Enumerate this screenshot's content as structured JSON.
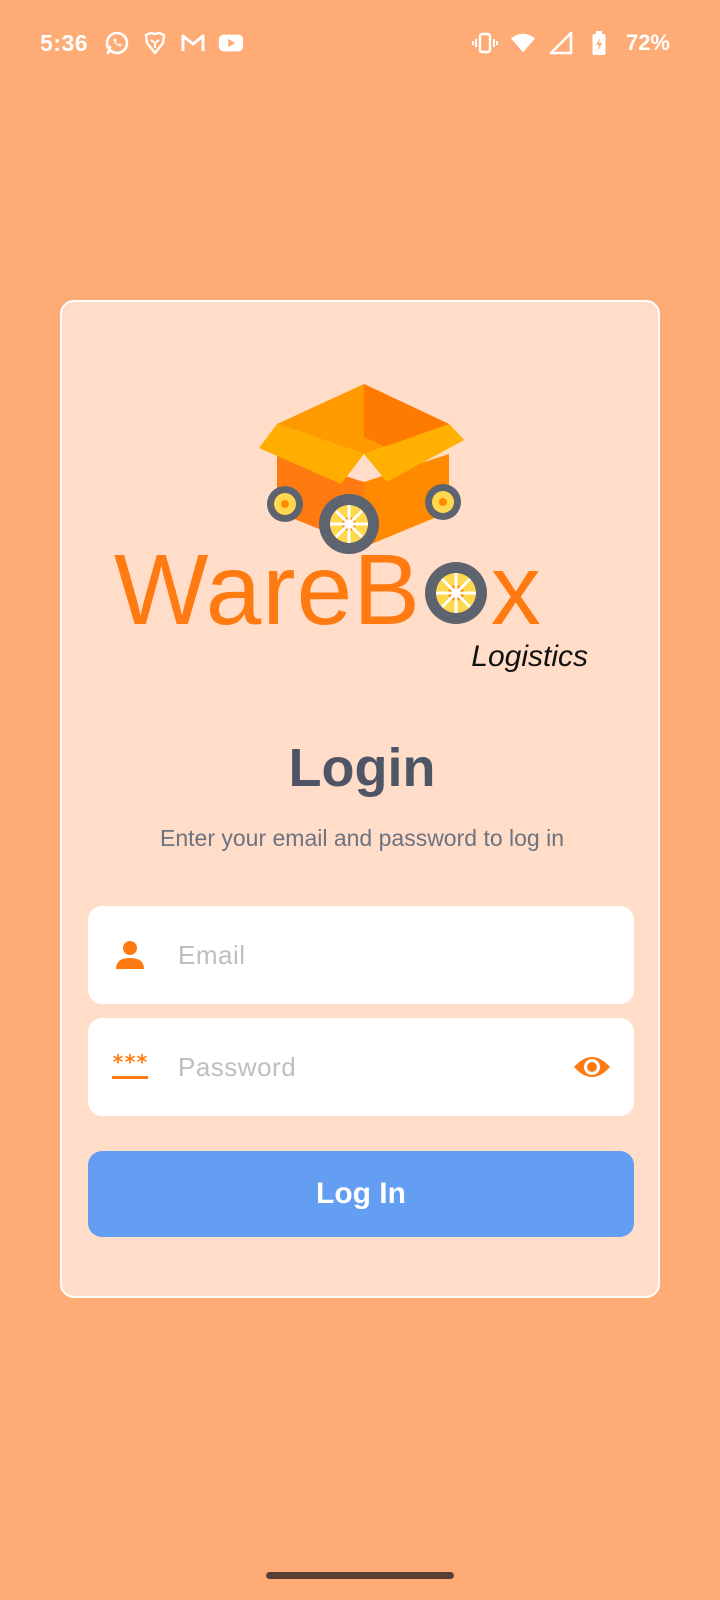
{
  "status_bar": {
    "time": "5:36",
    "left_icons": [
      "whatsapp-icon",
      "brave-icon",
      "gmail-icon",
      "youtube-icon"
    ],
    "right_icons": [
      "vibrate-icon",
      "wifi-icon",
      "signal-icon",
      "battery-charging-icon"
    ],
    "battery": "72%"
  },
  "logo": {
    "brand": "WareBox",
    "brand_prefix": "WareB",
    "brand_suffix": "x",
    "tagline": "Logistics"
  },
  "login": {
    "title": "Login",
    "subtitle": "Enter your email and password to log in",
    "email_placeholder": "Email",
    "password_placeholder": "Password",
    "password_mask_icon": "***",
    "submit_label": "Log In"
  },
  "colors": {
    "background": "#FFAB76",
    "card": "#FFDDC8",
    "accent": "#FF7A10",
    "button": "#639EF2",
    "title": "#4E5566"
  }
}
